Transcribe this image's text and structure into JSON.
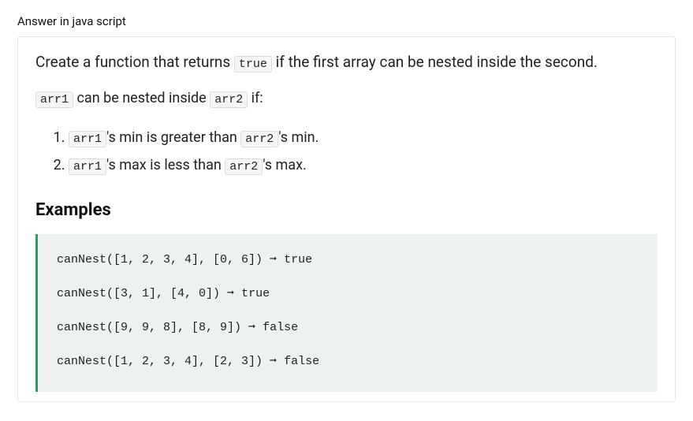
{
  "header": "Answer in java script",
  "lead_parts": {
    "p1": "Create a function that returns ",
    "code1": "true",
    "p2": " if the first array can be nested inside the second."
  },
  "sub_parts": {
    "code1": "arr1",
    "t1": " can be nested inside ",
    "code2": "arr2",
    "t2": " if:"
  },
  "rules": [
    {
      "code1": "arr1",
      "t1": "'s min is greater than ",
      "code2": "arr2",
      "t2": "'s min."
    },
    {
      "code1": "arr1",
      "t1": "'s max is less than ",
      "code2": "arr2",
      "t2": "'s max."
    }
  ],
  "examples_heading": "Examples",
  "code_lines": [
    "canNest([1, 2, 3, 4], [0, 6]) ➞ true",
    "canNest([3, 1], [4, 0]) ➞ true",
    "canNest([9, 9, 8], [8, 9]) ➞ false",
    "canNest([1, 2, 3, 4], [2, 3]) ➞ false"
  ]
}
